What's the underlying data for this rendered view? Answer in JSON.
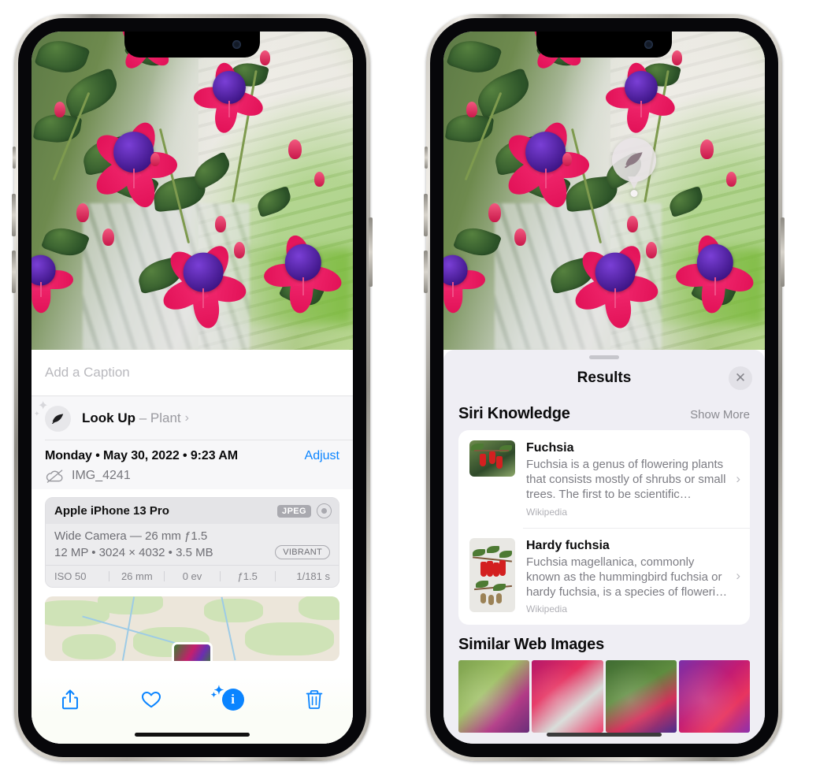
{
  "left_phone": {
    "name": "photos-detail-view",
    "caption_placeholder": "Add a Caption",
    "lookup": {
      "icon": "leaf-icon",
      "label": "Look Up",
      "dash": " – ",
      "subject": "Plant",
      "chevron": "›"
    },
    "meta": {
      "date": "Monday • May 30, 2022 • 9:23 AM",
      "adjust_label": "Adjust",
      "cloud_icon": "cloud-slash-icon",
      "filename": "IMG_4241"
    },
    "exif": {
      "device": "Apple iPhone 13 Pro",
      "format_badge": "JPEG",
      "raw_icon": "raw-circle-icon",
      "lens_line": "Wide Camera — 26 mm ƒ1.5",
      "size_line": "12 MP • 3024 × 4032 • 3.5 MB",
      "vibrant_badge": "VIBRANT",
      "stats": [
        "ISO 50",
        "26 mm",
        "0 ev",
        "ƒ1.5",
        "1/181 s"
      ]
    },
    "map": {
      "name": "location-map"
    },
    "toolbar": [
      {
        "name": "share-button",
        "icon": "share-icon"
      },
      {
        "name": "favorite-button",
        "icon": "heart-icon"
      },
      {
        "name": "info-button",
        "icon": "info-sparkle-icon",
        "glyph": "i"
      },
      {
        "name": "delete-button",
        "icon": "trash-icon"
      }
    ]
  },
  "right_phone": {
    "name": "visual-lookup-results-view",
    "pin": {
      "icon": "leaf-icon"
    },
    "sheet": {
      "grabber": "drag-handle",
      "title": "Results",
      "close_icon": "✕"
    },
    "siri_knowledge": {
      "section_title": "Siri Knowledge",
      "show_more": "Show More",
      "items": [
        {
          "title": "Fuchsia",
          "description": "Fuchsia is a genus of flowering plants that consists mostly of shrubs or small trees. The first to be scientific…",
          "source": "Wikipedia",
          "chevron": "›"
        },
        {
          "title": "Hardy fuchsia",
          "description": "Fuchsia magellanica, commonly known as the hummingbird fuchsia or hardy fuchsia, is a species of floweri…",
          "source": "Wikipedia",
          "chevron": "›"
        }
      ]
    },
    "similar_web_images": {
      "section_title": "Similar Web Images",
      "count": 4
    }
  },
  "colors": {
    "accent_blue": "#0a84ff",
    "sheet_bg": "#efeef4",
    "card_bg": "#ffffff",
    "exif_bg": "#ececee",
    "secondary_text": "#7c7c83",
    "tertiary_text": "#b0b0b6"
  }
}
